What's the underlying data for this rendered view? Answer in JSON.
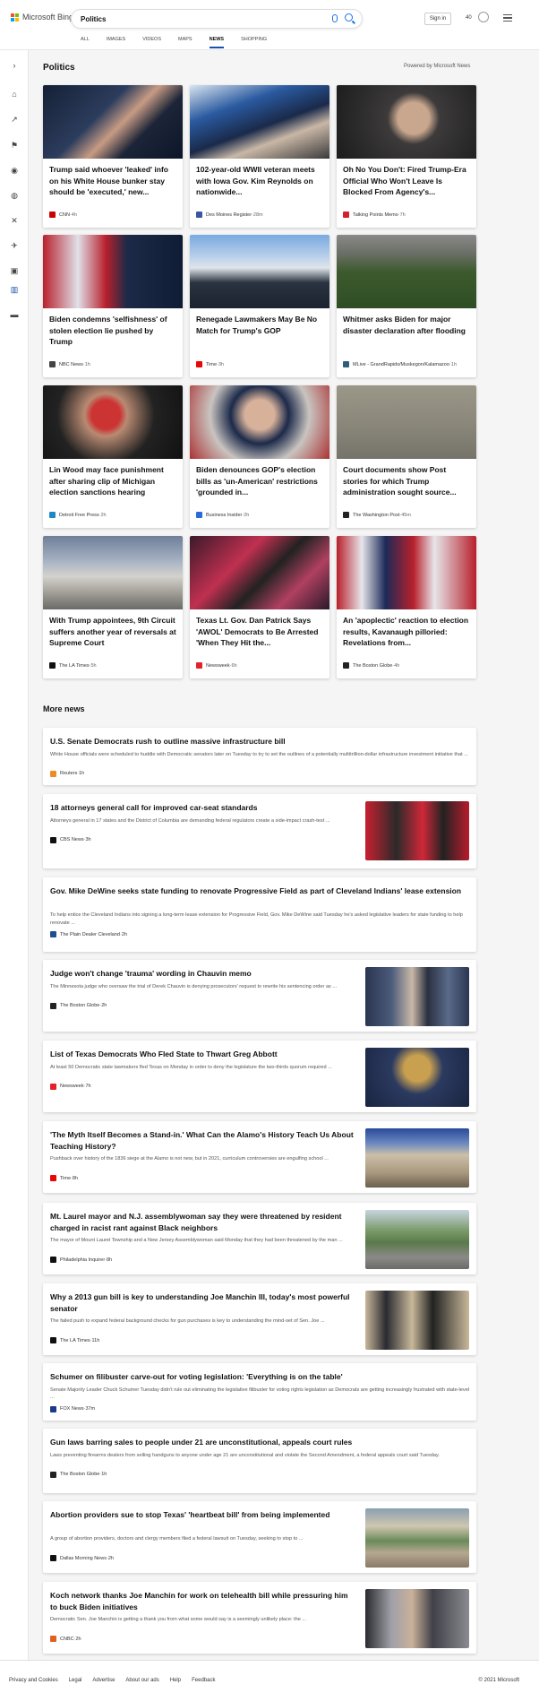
{
  "app": {
    "logo_text": "Microsoft Bing"
  },
  "search": {
    "query": "Politics"
  },
  "header": {
    "signin": "Sign in",
    "points": "40"
  },
  "tabs": [
    "ALL",
    "IMAGES",
    "VIDEOS",
    "MAPS",
    "NEWS",
    "SHOPPING"
  ],
  "active_tab": "NEWS",
  "section": {
    "title": "Politics",
    "powered": "Powered by Microsoft News"
  },
  "cards": [
    {
      "title": "Trump said whoever 'leaked' info on his White House bunker stay should be 'executed,' new...",
      "source": "CNN",
      "time": "4h",
      "logo": "#cc0000",
      "img": "linear-gradient(135deg,#152036 0%,#2c3c5c 40%,#c79b84 55%,#1c2538 70%,#0d1628 100%)"
    },
    {
      "title": "102-year-old WWII veteran meets with Iowa Gov. Kim Reynolds on nationwide...",
      "source": "Des Moines Register",
      "time": "28m",
      "logo": "#3a55a4",
      "img": "linear-gradient(160deg,#d8e4ef 0%,#2a5aa0 30%,#1a2a4a 55%,#c9b7a6 70%,#3a3a3a 100%)"
    },
    {
      "title": "Oh No You Don't: Fired Trump-Era Official Who Won't Leave Is Blocked From Agency's...",
      "source": "Talking Points Memo",
      "time": "7h",
      "logo": "#d62027",
      "img": "radial-gradient(circle at 55% 45%,#c9a78e 0 18%,#3c3a3a 30%,#1c1c1c 100%)"
    },
    {
      "title": "Biden condemns 'selfishness' of stolen election lie pushed by Trump",
      "source": "NBC News",
      "time": "1h",
      "logo": "#444",
      "img": "linear-gradient(90deg,#b8202c 0%,#e0e0e8 25%,#b8202c 45%,#1c2a48 60%,#0f1c34 100%)"
    },
    {
      "title": "Renegade Lawmakers May Be No Match for Trump's GOP",
      "source": "Time",
      "time": "3h",
      "logo": "#e90606",
      "img": "linear-gradient(180deg,#7aa9e0 0%,#b9d0ea 30%,#dfe5ea 45%,#2a3340 65%,#1b2230 100%)"
    },
    {
      "title": "Whitmer asks Biden for major disaster declaration after flooding",
      "source": "MLive - GrandRapids/Muskegon/Kalamazoo",
      "time": "1h",
      "logo": "#2f5d7c",
      "img": "linear-gradient(180deg,#8a8a88 0%,#6b6f67 25%,#3d5a2e 50%,#2f4d24 100%)"
    },
    {
      "title": "Lin Wood may face punishment after sharing clip of Michigan election sanctions hearing",
      "source": "Detroit Free Press",
      "time": "2h",
      "logo": "#1e88c7",
      "img": "radial-gradient(circle at 45% 40%,#c33 0 16%,#b98a72 24%,#222 55%,#111 100%)"
    },
    {
      "title": "Biden denounces GOP's election bills as 'un-American' restrictions 'grounded in...",
      "source": "Business Insider",
      "time": "2h",
      "logo": "#2a6bd6",
      "img": "radial-gradient(circle at 50% 40%,#d7b19a 0 18%,#1c2a4a 35%,#c9c4c0 60%,#a33 100%)"
    },
    {
      "title": "Court documents show Post stories for which Trump administration sought source...",
      "source": "The Washington Post",
      "time": "45m",
      "logo": "#222",
      "img": "linear-gradient(180deg,#9b9788 0%,#8b887b 50%,#76736a 100%)"
    },
    {
      "title": "With Trump appointees, 9th Circuit suffers another year of reversals at Supreme Court",
      "source": "The LA Times",
      "time": "5h",
      "logo": "#111",
      "img": "linear-gradient(180deg,#6f7f9a 0%,#a9b4c4 35%,#d4d2cc 55%,#9a9890 80%,#6a6a68 100%)"
    },
    {
      "title": "Texas Lt. Gov. Dan Patrick Says 'AWOL' Democrats to Be Arrested 'When They Hit the...",
      "source": "Newsweek",
      "time": "6h",
      "logo": "#e3222b",
      "img": "linear-gradient(135deg,#3a1a2a 0%,#c03050 35%,#222 55%,#b04060 75%,#2a1a2a 100%)"
    },
    {
      "title": "An 'apoplectic' reaction to election results, Kavanaugh pilloried: Revelations from...",
      "source": "The Boston Globe",
      "time": "4h",
      "logo": "#222",
      "img": "linear-gradient(90deg,#b8202c 0%,#e6e6ea 18%,#1c2a58 35%,#b8202c 55%,#e6e6ea 70%,#b8202c 100%)"
    }
  ],
  "more": {
    "title": "More news"
  },
  "news": [
    {
      "title": "U.S. Senate Democrats rush to outline massive infrastructure bill",
      "desc": "White House officials were scheduled to huddle with Democratic senators later on Tuesday to try to set the outlines of a potentially multitrillion-dollar infrastructure investment initiative that ...",
      "source": "Reuters",
      "time": "1h",
      "logo": "#f08a24",
      "img": ""
    },
    {
      "title": "18 attorneys general call for improved car-seat standards",
      "desc": "Attorneys general in 17 states and the District of Columbia are demanding federal regulators create a side-impact crash-test ...",
      "source": "CBS News",
      "time": "3h",
      "logo": "#111",
      "img": "linear-gradient(90deg,#c82030 0%,#2a2a2a 30%,#d02838 55%,#222 75%,#b81c2c 100%)"
    },
    {
      "title": "Gov. Mike DeWine seeks state funding to renovate Progressive Field as part of Cleveland Indians' lease extension",
      "desc": "To help entice the Cleveland Indians into signing a long-term lease extension for Progressive Field, Gov. Mike DeWine said Tuesday he's asked legislative leaders for state funding to help renovate ...",
      "source": "The Plain Dealer Cleveland",
      "time": "2h",
      "logo": "#1f4f8f",
      "img": ""
    },
    {
      "title": "Judge won't change 'trauma' wording in Chauvin memo",
      "desc": "The Minnesota judge who oversaw the trial of Derek Chauvin is denying prosecutors' request to rewrite his sentencing order as ...",
      "source": "The Boston Globe",
      "time": "2h",
      "logo": "#222",
      "img": "linear-gradient(90deg,#2b3550 0%,#4a5a7a 25%,#c9b8a8 45%,#2a3040 60%,#5a6a8a 80%,#2b3550 100%)"
    },
    {
      "title": "List of Texas Democrats Who Fled State to Thwart Greg Abbott",
      "desc": "At least 50 Democratic state lawmakers fled Texas on Monday in order to deny the legislature the two-thirds quorum required ...",
      "source": "Newsweek",
      "time": "7h",
      "logo": "#e3222b",
      "img": "radial-gradient(circle at 50% 35%,#c9a050 0 20%,#2b3a60 40%,#1a2440 100%)"
    },
    {
      "title": "'The Myth Itself Becomes a Stand-in.' What Can the Alamo's History Teach Us About Teaching History?",
      "desc": "Pushback over history of the 1836 siege at the Alamo is not new, but in 2021, curriculum controversies are engulfing school ...",
      "source": "Time",
      "time": "8h",
      "logo": "#e90606",
      "img": "linear-gradient(180deg,#2a4a9a 0%,#6a88c0 25%,#cbbfa8 45%,#a9987e 75%,#6a604f 100%)"
    },
    {
      "title": "Mt. Laurel mayor and N.J. assemblywoman say they were threatened by resident charged in racist rant against Black neighbors",
      "desc": "The mayor of Mount Laurel Township and a New Jersey Assemblywoman said Monday that they had been threatened by the man ...",
      "source": "Philadelphia Inquirer",
      "time": "8h",
      "logo": "#111",
      "img": "linear-gradient(180deg,#c8d4e0 0%,#7a9a6a 35%,#5a7a4a 55%,#8a8a88 80%,#6a6a68 100%)"
    },
    {
      "title": "Why a 2013 gun bill is key to understanding Joe Manchin III, today's most powerful senator",
      "desc": "The failed push to expand federal background checks for gun purchases is key to understanding the mind-set of Sen. Joe ...",
      "source": "The LA Times",
      "time": "11h",
      "logo": "#111",
      "img": "linear-gradient(90deg,#c8b89a 0%,#2a2a30 20%,#c8b89a 45%,#222 65%,#c8b89a 100%)"
    },
    {
      "title": "Schumer on filibuster carve-out for voting legislation: 'Everything is on the table'",
      "desc": "Senate Majority Leader Chuck Schumer Tuesday didn't rule out eliminating the legislative filibuster for voting rights legislation as Democrats are getting increasingly frustrated with state-level ...",
      "source": "FOX News",
      "time": "37m",
      "logo": "#1a3a8a",
      "img": ""
    },
    {
      "title": "Gun laws barring sales to people under 21 are unconstitutional, appeals court rules",
      "desc": "Laws preventing firearms dealers from selling handguns to anyone under age 21 are unconstitutional and violate the Second Amendment, a federal appeals court said Tuesday.",
      "source": "The Boston Globe",
      "time": "1h",
      "logo": "#222",
      "img": ""
    },
    {
      "title": "Abortion providers sue to stop Texas' 'heartbeat bill' from being implemented",
      "desc": "A group of abortion providers, doctors and clergy members filed a federal lawsuit on Tuesday, seeking to stop to ...",
      "source": "Dallas Morning News",
      "time": "2h",
      "logo": "#111",
      "img": "linear-gradient(180deg,#8aa0b0 0%,#cfc6b0 30%,#6a8a5a 55%,#b5a890 75%,#8a7a68 100%)"
    },
    {
      "title": "Koch network thanks Joe Manchin for work on telehealth bill while pressuring him to buck Biden initiatives",
      "desc": "Democratic Sen. Joe Manchin is getting a thank you from what some would say is a seemingly unlikely place: the ...",
      "source": "CNBC",
      "time": "2h",
      "logo": "#e06020",
      "img": "linear-gradient(90deg,#2a2a30 0%,#a0a0a8 25%,#c9b09a 45%,#404048 65%,#8a8a90 100%)"
    }
  ],
  "footer": {
    "links": [
      "Privacy and Cookies",
      "Legal",
      "Advertise",
      "About our ads",
      "Help",
      "Feedback"
    ],
    "copyright": "© 2021 Microsoft"
  }
}
